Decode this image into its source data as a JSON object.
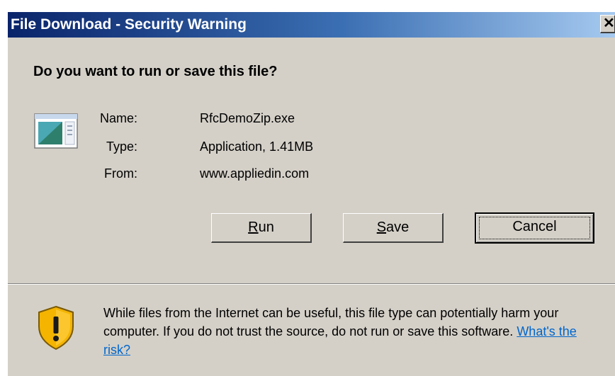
{
  "window": {
    "title": "File Download - Security Warning",
    "close_glyph": "✕"
  },
  "dialog": {
    "question": "Do you want to run or save this file?",
    "file_icon": "application-icon",
    "info": {
      "name_label": "Name:",
      "name_value": "RfcDemoZip.exe",
      "type_label": "Type:",
      "type_value": "Application, 1.41MB",
      "from_label": "From:",
      "from_value": "www.appliedin.com"
    },
    "buttons": {
      "run_mnemonic": "R",
      "run_rest": "un",
      "save_mnemonic": "S",
      "save_rest": "ave",
      "cancel": "Cancel"
    }
  },
  "warning": {
    "icon": "shield-warning-icon",
    "text": "While files from the Internet can be useful, this file type can potentially harm your computer. If you do not trust the source, do not run or save this software. ",
    "link": "What's the risk?"
  },
  "colors": {
    "title_gradient_start": "#0a246a",
    "title_gradient_end": "#a6caf0",
    "dialog_face": "#d4d0c8",
    "link": "#0066cc",
    "shield": "#f4b400"
  }
}
